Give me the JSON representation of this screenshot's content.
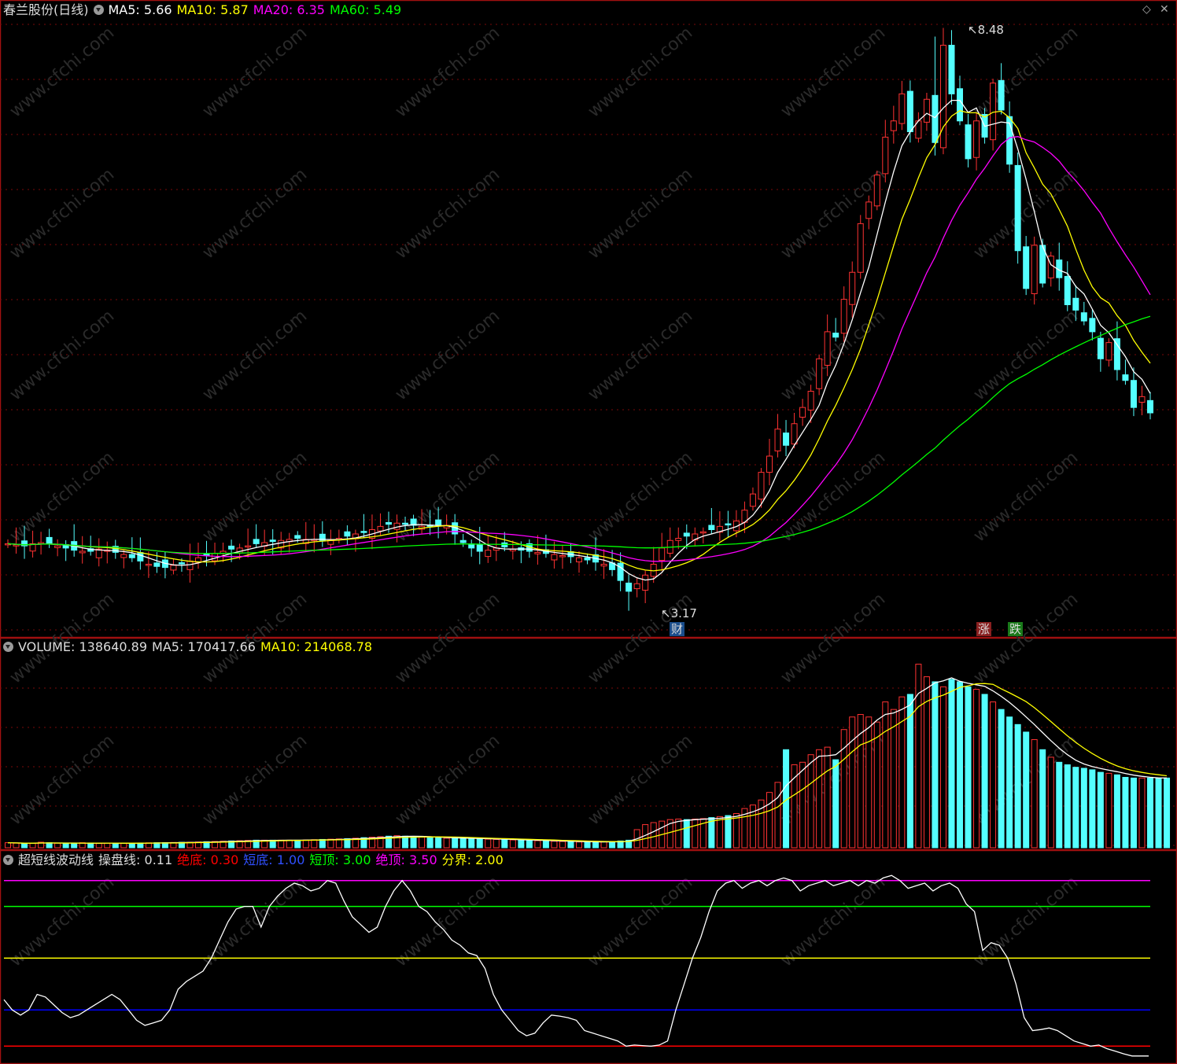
{
  "main_header": {
    "title": "春兰股份(日线)",
    "ma5": {
      "label": "MA5:",
      "value": "5.66",
      "color": "#ffffff"
    },
    "ma10": {
      "label": "MA10:",
      "value": "5.87",
      "color": "#ffff00"
    },
    "ma20": {
      "label": "MA20:",
      "value": "6.35",
      "color": "#ff00ff"
    },
    "ma60": {
      "label": "MA60:",
      "value": "5.49",
      "color": "#00ff00"
    }
  },
  "volume_header": {
    "volume": {
      "label": "VOLUME:",
      "value": "138640.89"
    },
    "ma5": {
      "label": "MA5:",
      "value": "170417.66"
    },
    "ma10": {
      "label": "MA10:",
      "value": "214068.78"
    }
  },
  "indicator_header": {
    "name": "超短线波动线",
    "line": {
      "label": "操盘线:",
      "value": "0.11"
    },
    "jue_di": {
      "label": "绝底:",
      "value": "0.30",
      "color": "#ff0000"
    },
    "duan_di": {
      "label": "短底:",
      "value": "1.00",
      "color": "#0000ff"
    },
    "duan_ding": {
      "label": "短顶:",
      "value": "3.00",
      "color": "#00ff00"
    },
    "jue_ding": {
      "label": "绝顶:",
      "value": "3.50",
      "color": "#ff00ff"
    },
    "fen_jie": {
      "label": "分界:",
      "value": "2.00",
      "color": "#ffff00"
    }
  },
  "annotations": {
    "high_label": "8.48",
    "low_label": "3.17",
    "tag_cai": "财",
    "tag_zhang": "涨",
    "tag_die": "跌"
  },
  "watermark": "www.cfchi.com",
  "icons": [
    "collapse-arrow-icon",
    "diamond-icon",
    "close-icon"
  ],
  "chart_data": [
    {
      "type": "candlestick",
      "title": "春兰股份(日线)",
      "price_range": [
        3.0,
        8.6
      ],
      "note_high": 8.48,
      "note_low": 3.17,
      "closes": [
        3.79,
        3.78,
        3.77,
        3.79,
        3.8,
        3.79,
        3.77,
        3.75,
        3.73,
        3.72,
        3.72,
        3.74,
        3.73,
        3.71,
        3.69,
        3.66,
        3.63,
        3.6,
        3.58,
        3.57,
        3.59,
        3.61,
        3.63,
        3.66,
        3.68,
        3.7,
        3.72,
        3.74,
        3.75,
        3.77,
        3.79,
        3.8,
        3.81,
        3.82,
        3.83,
        3.84,
        3.83,
        3.83,
        3.82,
        3.82,
        3.84,
        3.86,
        3.88,
        3.9,
        3.92,
        3.95,
        3.97,
        3.98,
        3.97,
        3.96,
        3.95,
        3.95,
        3.96,
        3.96,
        3.88,
        3.8,
        3.75,
        3.72,
        3.73,
        3.75,
        3.76,
        3.74,
        3.73,
        3.72,
        3.71,
        3.7,
        3.69,
        3.68,
        3.67,
        3.66,
        3.64,
        3.62,
        3.6,
        3.55,
        3.45,
        3.35,
        3.42,
        3.5,
        3.6,
        3.75,
        3.82,
        3.84,
        3.86,
        3.88,
        3.9,
        3.92,
        3.95,
        3.97,
        4.0,
        4.1,
        4.25,
        4.45,
        4.6,
        4.85,
        4.7,
        4.9,
        5.05,
        5.2,
        5.5,
        5.75,
        5.7,
        6.05,
        6.3,
        6.75,
        6.95,
        7.2,
        7.55,
        7.7,
        7.95,
        7.6,
        7.7,
        7.9,
        7.5,
        8.4,
        7.95,
        7.7,
        7.35,
        7.7,
        7.55,
        8.05,
        7.8,
        7.3,
        6.5,
        6.15,
        6.55,
        6.2,
        6.45,
        6.25,
        6.0,
        5.95,
        5.85,
        5.75,
        5.5,
        5.65,
        5.4,
        5.3,
        5.05,
        5.15,
        5.0
      ],
      "series": [
        {
          "name": "MA5",
          "color": "#ffffff"
        },
        {
          "name": "MA10",
          "color": "#ffff00"
        },
        {
          "name": "MA20",
          "color": "#ff00ff"
        },
        {
          "name": "MA60",
          "color": "#00ff00"
        }
      ]
    },
    {
      "type": "bar",
      "title": "VOLUME",
      "volume_range": [
        0,
        380000
      ],
      "volumes": [
        10000,
        9000,
        8000,
        9000,
        11000,
        10000,
        9000,
        8000,
        9000,
        10000,
        9500,
        8500,
        9000,
        9000,
        8800,
        9200,
        9500,
        9800,
        10000,
        10200,
        10500,
        10800,
        11000,
        11500,
        12000,
        12500,
        13000,
        13500,
        14000,
        14500,
        15000,
        15000,
        15000,
        15000,
        15000,
        15000,
        15500,
        16000,
        16500,
        17000,
        17500,
        18000,
        19000,
        20000,
        21000,
        22000,
        23000,
        24000,
        23000,
        22000,
        21000,
        20000,
        19500,
        19000,
        19000,
        18500,
        18000,
        17500,
        17000,
        16500,
        16000,
        15500,
        15000,
        14500,
        14000,
        13500,
        13000,
        12500,
        12000,
        11500,
        11000,
        11500,
        12000,
        12500,
        13500,
        15000,
        36000,
        46000,
        50000,
        53000,
        56000,
        57000,
        56000,
        57000,
        58000,
        60000,
        62000,
        64000,
        68000,
        78000,
        85000,
        95000,
        110000,
        130000,
        195000,
        165000,
        170000,
        185000,
        195000,
        200000,
        175000,
        235000,
        260000,
        265000,
        260000,
        250000,
        290000,
        275000,
        300000,
        305000,
        365000,
        340000,
        330000,
        320000,
        335000,
        330000,
        320000,
        315000,
        305000,
        290000,
        275000,
        260000,
        245000,
        230000,
        215000,
        195000,
        180000,
        170000,
        165000,
        160000,
        158000,
        155000,
        150000,
        148000,
        145000,
        140000,
        138641,
        138641,
        138641,
        138641,
        138641
      ],
      "series": [
        {
          "name": "MA5",
          "color": "#ffffff"
        },
        {
          "name": "MA10",
          "color": "#ffff00"
        }
      ]
    },
    {
      "type": "line",
      "title": "超短线波动线",
      "ylim": [
        0,
        3.8
      ],
      "levels": [
        {
          "name": "绝底",
          "value": 0.3,
          "color": "#ff0000"
        },
        {
          "name": "短底",
          "value": 1.0,
          "color": "#0000ff"
        },
        {
          "name": "分界",
          "value": 2.0,
          "color": "#ffff00"
        },
        {
          "name": "短顶",
          "value": 3.0,
          "color": "#00ff00"
        },
        {
          "name": "绝顶",
          "value": 3.5,
          "color": "#ff00ff"
        }
      ],
      "series": [
        {
          "name": "操盘线",
          "color": "#ffffff",
          "values": [
            1.2,
            1.0,
            0.9,
            1.0,
            1.3,
            1.25,
            1.1,
            0.95,
            0.85,
            0.9,
            1.0,
            1.1,
            1.2,
            1.3,
            1.2,
            1.0,
            0.8,
            0.7,
            0.75,
            0.8,
            1.0,
            1.4,
            1.55,
            1.65,
            1.75,
            2.0,
            2.35,
            2.7,
            2.95,
            3.0,
            3.0,
            2.6,
            3.0,
            3.2,
            3.35,
            3.45,
            3.4,
            3.3,
            3.35,
            3.5,
            3.45,
            3.1,
            2.8,
            2.65,
            2.5,
            2.6,
            3.0,
            3.3,
            3.5,
            3.3,
            3.0,
            2.9,
            2.7,
            2.55,
            2.35,
            2.25,
            2.1,
            2.05,
            1.8,
            1.3,
            1.0,
            0.8,
            0.6,
            0.5,
            0.55,
            0.75,
            0.9,
            0.88,
            0.85,
            0.8,
            0.6,
            0.55,
            0.5,
            0.45,
            0.4,
            0.3,
            0.32,
            0.31,
            0.3,
            0.32,
            0.4,
            1.0,
            1.5,
            2.0,
            2.4,
            2.9,
            3.3,
            3.45,
            3.5,
            3.35,
            3.45,
            3.5,
            3.4,
            3.5,
            3.55,
            3.5,
            3.3,
            3.4,
            3.45,
            3.5,
            3.4,
            3.45,
            3.5,
            3.4,
            3.5,
            3.45,
            3.55,
            3.6,
            3.5,
            3.35,
            3.4,
            3.45,
            3.3,
            3.4,
            3.45,
            3.35,
            3.05,
            2.9,
            2.15,
            2.3,
            2.25,
            2.0,
            1.5,
            0.85,
            0.6,
            0.62,
            0.65,
            0.6,
            0.5,
            0.4,
            0.35,
            0.3,
            0.32,
            0.25,
            0.2,
            0.15,
            0.11,
            0.11,
            0.11
          ]
        }
      ]
    }
  ]
}
